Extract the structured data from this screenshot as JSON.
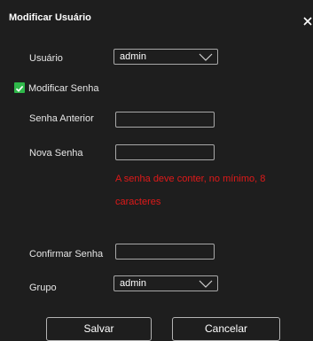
{
  "dialog": {
    "title": "Modificar Usuário",
    "close_icon": "close-icon"
  },
  "form": {
    "user_label": "Usuário",
    "user_value": "admin",
    "modify_password_label": "Modificar Senha",
    "modify_password_checked": true,
    "old_password_label": "Senha Anterior",
    "old_password_value": "",
    "new_password_label": "Nova Senha",
    "new_password_value": "",
    "warning_line1": "A senha deve conter, no mínimo, 8",
    "warning_line2": "caracteres",
    "confirm_password_label": "Confirmar Senha",
    "confirm_password_value": "",
    "group_label": "Grupo",
    "group_value": "admin"
  },
  "buttons": {
    "save_label": "Salvar",
    "cancel_label": "Cancelar"
  },
  "colors": {
    "background": "#1e1e1e",
    "checkbox": "#2fb84a",
    "warning": "#e01919"
  }
}
